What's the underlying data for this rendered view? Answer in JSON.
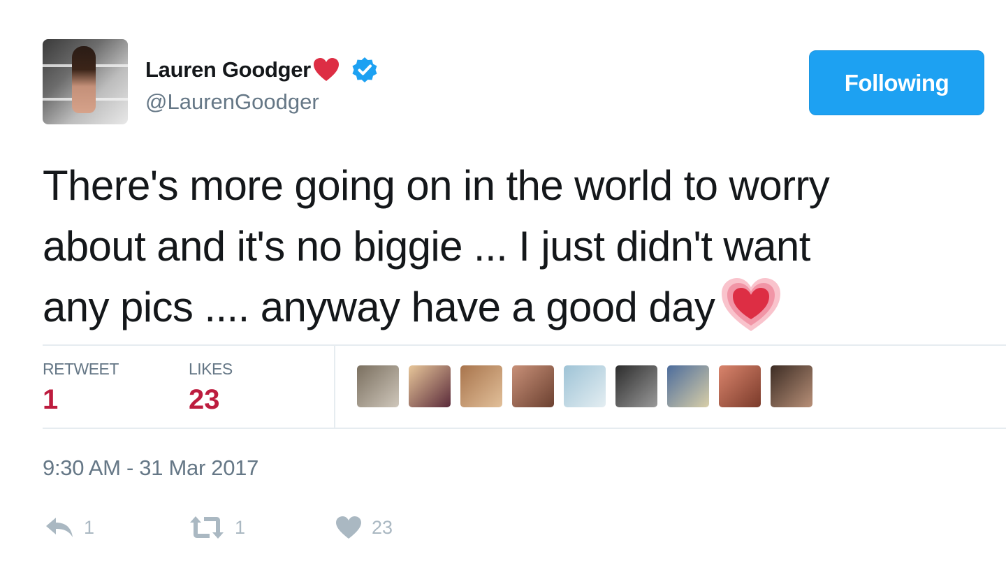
{
  "author": {
    "name": "Lauren Goodger",
    "handle": "@LaurenGoodger",
    "verified": true,
    "name_emoji": "heart-emoji"
  },
  "follow_button": {
    "label": "Following"
  },
  "tweet": {
    "lines": [
      "There's more going on in the world to worry",
      "about and it's no biggie ... I just didn't want",
      "any pics .... anyway have a good day"
    ],
    "trailing_emoji": "growing-heart-emoji"
  },
  "stats": {
    "retweets": {
      "label": "RETWEET",
      "value": "1"
    },
    "likes": {
      "label": "LIKES",
      "value": "23"
    }
  },
  "likers": [
    {
      "name": "liker-avatar-1",
      "color1": "#7a6f5f",
      "color2": "#cfc7bb"
    },
    {
      "name": "liker-avatar-2",
      "color1": "#e8c79a",
      "color2": "#5a2a3a"
    },
    {
      "name": "liker-avatar-3",
      "color1": "#a8744c",
      "color2": "#e2c09a"
    },
    {
      "name": "liker-avatar-4",
      "color1": "#c89078",
      "color2": "#6b4030"
    },
    {
      "name": "liker-avatar-5",
      "color1": "#9ec3d6",
      "color2": "#e4eef2"
    },
    {
      "name": "liker-avatar-6",
      "color1": "#2c2c2c",
      "color2": "#9a9a9a"
    },
    {
      "name": "liker-avatar-7",
      "color1": "#4c6c9c",
      "color2": "#d9cfa8"
    },
    {
      "name": "liker-avatar-8",
      "color1": "#d9846c",
      "color2": "#7a3a2a"
    },
    {
      "name": "liker-avatar-9",
      "color1": "#3c2c24",
      "color2": "#b89078"
    }
  ],
  "timestamp": "9:30 AM - 31 Mar 2017",
  "actions": {
    "reply": {
      "count": "1"
    },
    "retweet": {
      "count": "1"
    },
    "like": {
      "count": "23"
    }
  },
  "colors": {
    "accent": "#1da1f2",
    "like_red": "#bd1c3e",
    "muted": "#657786",
    "action_gray": "#aab8c2"
  }
}
